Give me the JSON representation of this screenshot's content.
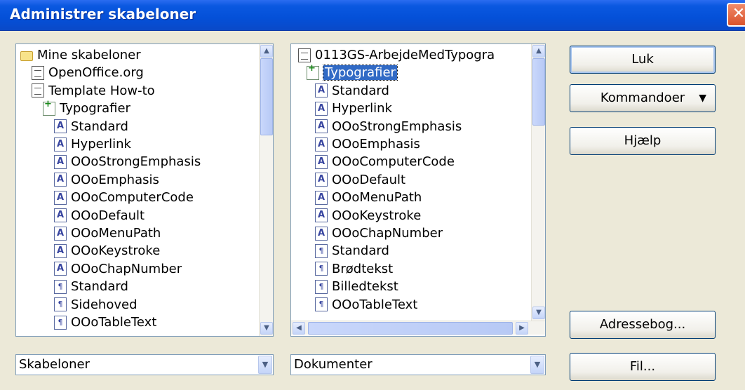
{
  "window": {
    "title": "Administrer skabeloner",
    "close_glyph": "✕"
  },
  "left_tree": {
    "items": [
      {
        "label": "Mine skabeloner",
        "icon": "folder-open-icon",
        "indent": 0
      },
      {
        "label": "OpenOffice.org",
        "icon": "document-icon",
        "indent": 1
      },
      {
        "label": "Template How-to",
        "icon": "document-icon",
        "indent": 1
      },
      {
        "label": "Typografier",
        "icon": "styles-icon",
        "indent": 2
      },
      {
        "label": "Standard",
        "icon": "character-style-icon",
        "indent": 3
      },
      {
        "label": "Hyperlink",
        "icon": "character-style-icon",
        "indent": 3
      },
      {
        "label": "OOoStrongEmphasis",
        "icon": "character-style-icon",
        "indent": 3
      },
      {
        "label": "OOoEmphasis",
        "icon": "character-style-icon",
        "indent": 3
      },
      {
        "label": "OOoComputerCode",
        "icon": "character-style-icon",
        "indent": 3
      },
      {
        "label": "OOoDefault",
        "icon": "character-style-icon",
        "indent": 3
      },
      {
        "label": "OOoMenuPath",
        "icon": "character-style-icon",
        "indent": 3
      },
      {
        "label": "OOoKeystroke",
        "icon": "character-style-icon",
        "indent": 3
      },
      {
        "label": "OOoChapNumber",
        "icon": "character-style-icon",
        "indent": 3
      },
      {
        "label": "Standard",
        "icon": "paragraph-style-icon",
        "indent": 3
      },
      {
        "label": "Sidehoved",
        "icon": "paragraph-style-icon",
        "indent": 3
      },
      {
        "label": "OOoTableText",
        "icon": "paragraph-style-icon",
        "indent": 3
      }
    ]
  },
  "right_tree": {
    "items": [
      {
        "label": "0113GS-ArbejdeMedTypogra",
        "icon": "document-icon",
        "indent": 0
      },
      {
        "label": "Typografier",
        "icon": "styles-icon",
        "indent": 1,
        "selected": true
      },
      {
        "label": "Standard",
        "icon": "character-style-icon",
        "indent": 2
      },
      {
        "label": "Hyperlink",
        "icon": "character-style-icon",
        "indent": 2
      },
      {
        "label": "OOoStrongEmphasis",
        "icon": "character-style-icon",
        "indent": 2
      },
      {
        "label": "OOoEmphasis",
        "icon": "character-style-icon",
        "indent": 2
      },
      {
        "label": "OOoComputerCode",
        "icon": "character-style-icon",
        "indent": 2
      },
      {
        "label": "OOoDefault",
        "icon": "character-style-icon",
        "indent": 2
      },
      {
        "label": "OOoMenuPath",
        "icon": "character-style-icon",
        "indent": 2
      },
      {
        "label": "OOoKeystroke",
        "icon": "character-style-icon",
        "indent": 2
      },
      {
        "label": "OOoChapNumber",
        "icon": "character-style-icon",
        "indent": 2
      },
      {
        "label": "Standard",
        "icon": "paragraph-style-icon",
        "indent": 2
      },
      {
        "label": "Brødtekst",
        "icon": "paragraph-style-icon",
        "indent": 2
      },
      {
        "label": "Billedtekst",
        "icon": "paragraph-style-icon",
        "indent": 2
      },
      {
        "label": "OOoTableText",
        "icon": "paragraph-style-icon",
        "indent": 2
      }
    ]
  },
  "left_combo": {
    "value": "Skabeloner"
  },
  "right_combo": {
    "value": "Dokumenter"
  },
  "buttons": {
    "close": "Luk",
    "commands": "Kommandoer",
    "help": "Hjælp",
    "addressbook": "Adressebog...",
    "file": "Fil..."
  },
  "colors": {
    "titlebar": "#0450d8",
    "selection": "#316ac5",
    "dialog_bg": "#ece9d8"
  }
}
